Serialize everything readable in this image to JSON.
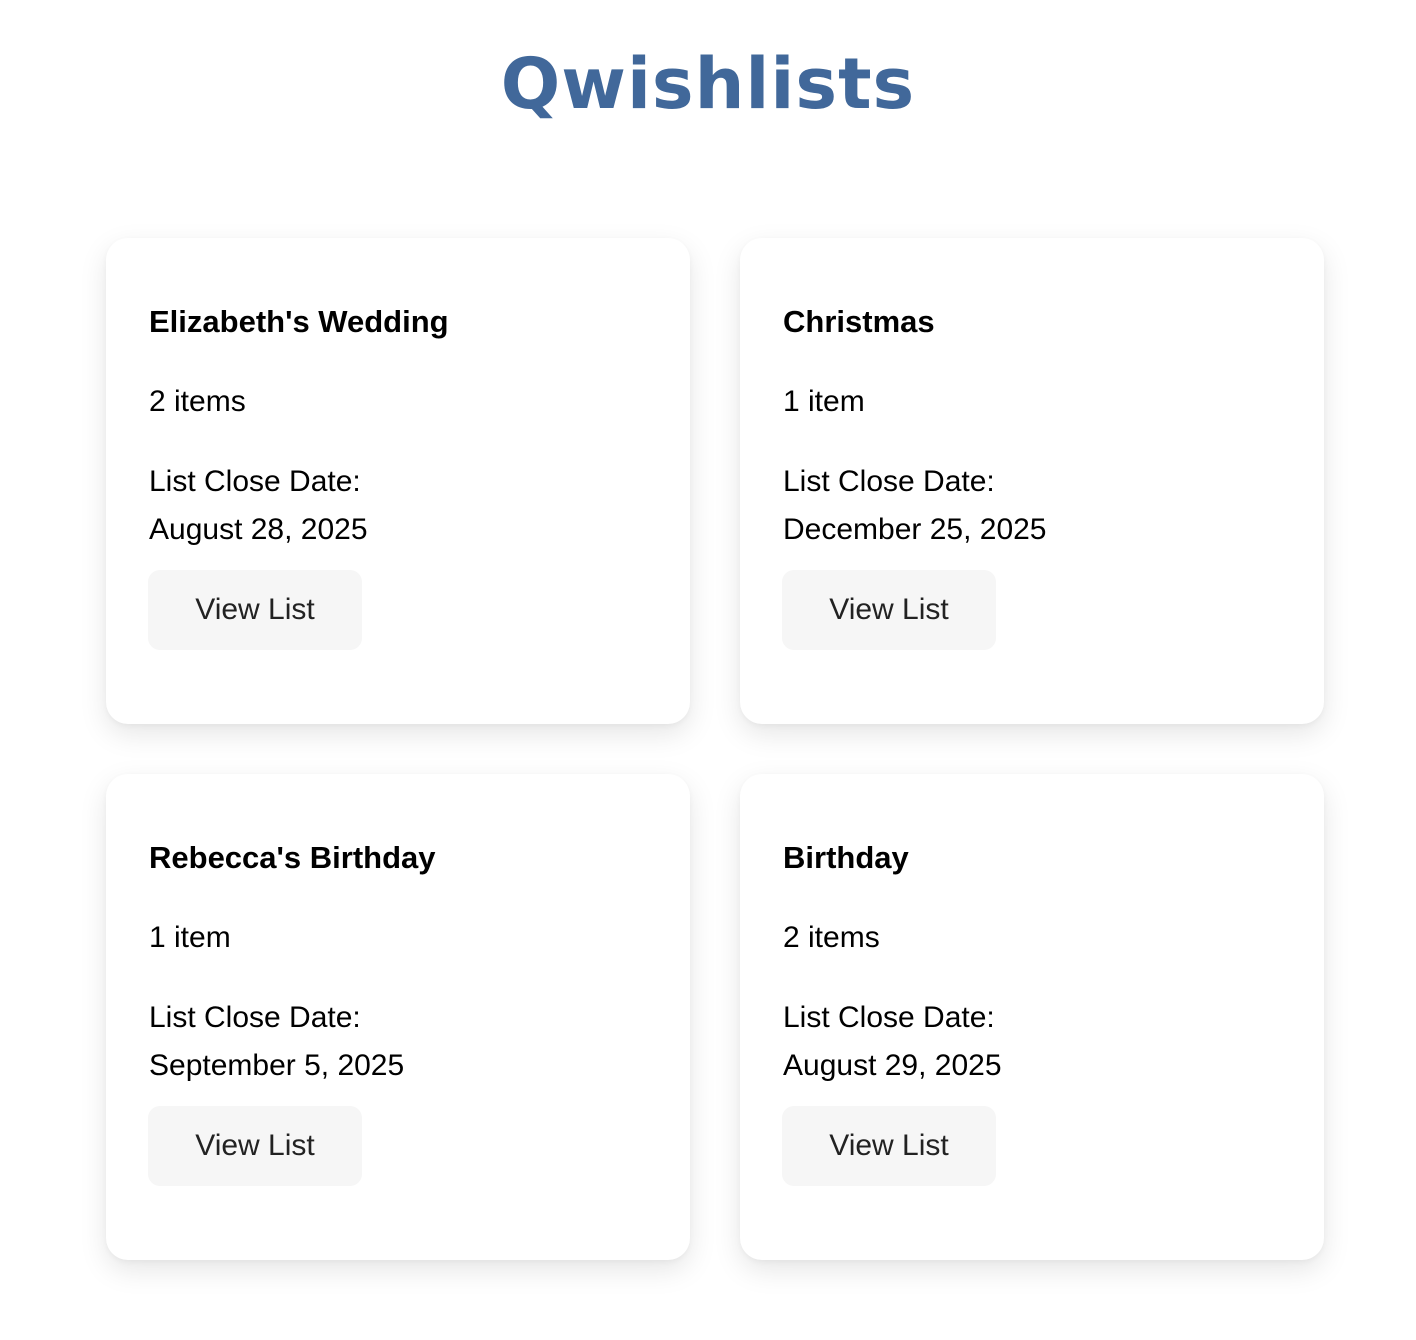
{
  "header": {
    "title": "Qwishlists",
    "title_color": "#41689a"
  },
  "wishlists": [
    {
      "title": "Elizabeth's Wedding",
      "item_count": "2 items",
      "close_label": "List Close Date:",
      "close_date": "August 28, 2025",
      "button_label": "View List"
    },
    {
      "title": "Christmas",
      "item_count": "1 item",
      "close_label": "List Close Date:",
      "close_date": "December 25, 2025",
      "button_label": "View List"
    },
    {
      "title": "Rebecca's Birthday",
      "item_count": "1 item",
      "close_label": "List Close Date:",
      "close_date": "September 5, 2025",
      "button_label": "View List"
    },
    {
      "title": "Birthday",
      "item_count": "2 items",
      "close_label": "List Close Date:",
      "close_date": "August 29, 2025",
      "button_label": "View List"
    }
  ],
  "colors": {
    "background": "#ffffff",
    "card_background": "#ffffff",
    "button_background": "#f6f6f6",
    "text": "#000000"
  }
}
